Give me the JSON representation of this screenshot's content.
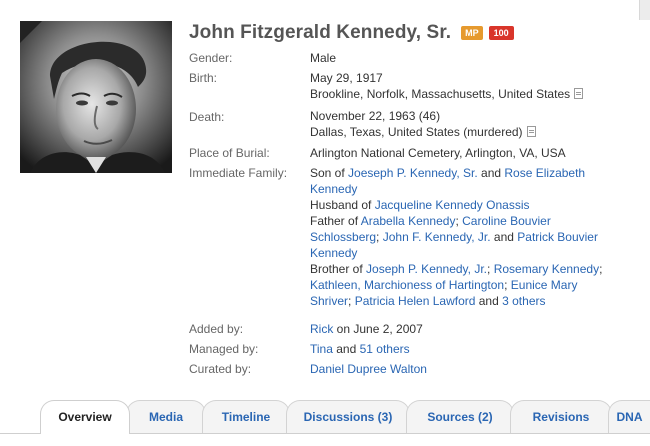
{
  "profile": {
    "name": "John Fitzgerald Kennedy, Sr.",
    "badge_mp": "MP",
    "badge_count": "100"
  },
  "facts": {
    "gender_label": "Gender:",
    "gender": "Male",
    "birth_label": "Birth:",
    "birth_date": "May 29, 1917",
    "birth_place": "Brookline, Norfolk, Massachusetts, United States",
    "death_label": "Death:",
    "death_date": "November 22, 1963 (46)",
    "death_place": "Dallas, Texas, United States (murdered)",
    "burial_label": "Place of Burial:",
    "burial": "Arlington National Cemetery, Arlington, VA, USA",
    "family_label": "Immediate Family:",
    "added_by_label": "Added by:",
    "added_by": "Rick",
    "added_on": " on June 2, 2007",
    "managed_by_label": "Managed by:",
    "managed_by": "Tina",
    "managed_and": " and ",
    "managed_others": "51 others",
    "curated_by_label": "Curated by:",
    "curated_by": "Daniel Dupree Walton"
  },
  "family": {
    "son_of": "Son of ",
    "father_name": "Joeseph P. Kennedy, Sr.",
    "and1": " and ",
    "mother_name_a": "Rose Elizabeth",
    "mother_name_b": "Kennedy",
    "husband_of": "Husband of ",
    "spouse": "Jacqueline Kennedy Onassis",
    "father_of": "Father of ",
    "child1": "Arabella Kennedy",
    "sep1": "; ",
    "child2_a": "Caroline Bouvier",
    "child2_b": "Schlossberg",
    "sep2": "; ",
    "child3": "John F. Kennedy, Jr.",
    "and2": " and ",
    "child4_a": "Patrick Bouvier",
    "child4_b": "Kennedy",
    "brother_of": "Brother of ",
    "sib1": "Joseph P. Kennedy, Jr.",
    "sep3": "; ",
    "sib2": "Rosemary Kennedy",
    "sep4": ";",
    "sib3": "Kathleen, Marchioness of Hartington",
    "sep5": "; ",
    "sib4_a": "Eunice Mary",
    "sib4_b": "Shriver",
    "sep6": "; ",
    "sib5": "Patricia Helen Lawford",
    "and3": " and ",
    "sib_more": "3 others"
  },
  "tabs": [
    "Overview",
    "Media",
    "Timeline",
    "Discussions (3)",
    "Sources (2)",
    "Revisions",
    "DNA"
  ],
  "colors": {
    "link": "#2a66b3",
    "badge_mp": "#e69a2e",
    "badge_count": "#d9352a"
  }
}
